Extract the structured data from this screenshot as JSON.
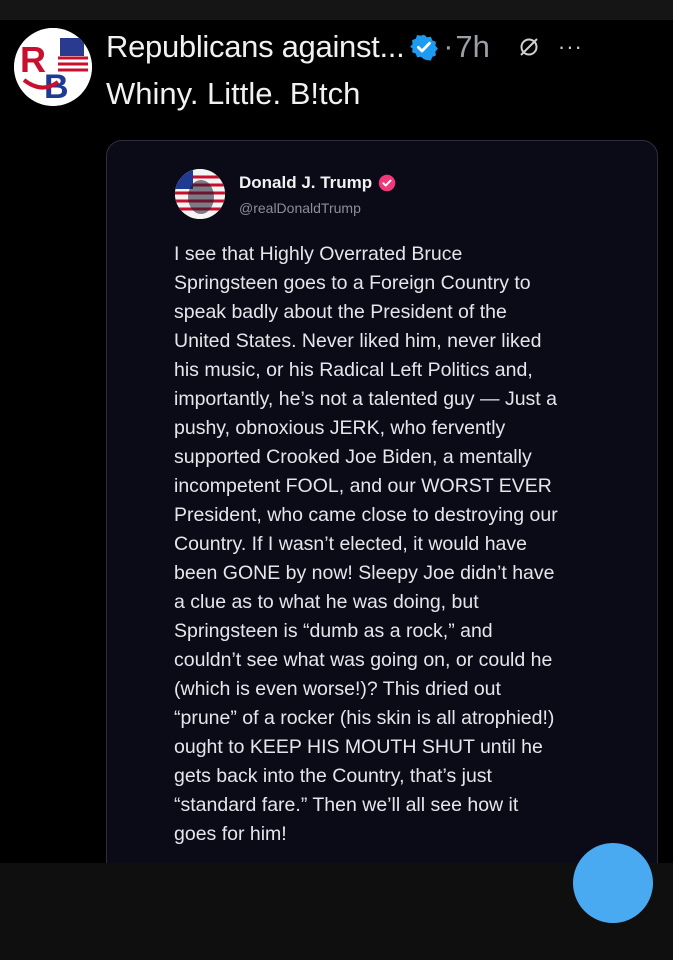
{
  "post": {
    "author_name": "Republicans against...",
    "avatar_initials": "RB",
    "separator": "·",
    "time_ago": "7h",
    "more_label": "···",
    "text": "Whiny. Little. B!tch",
    "verified_icon": "verified-badge-icon",
    "grok_icon": "grok-slash-icon"
  },
  "quote": {
    "name": "Donald J. Trump",
    "handle": "@realDonaldTrump",
    "badge_icon": "verified-badge-icon",
    "lines": [
      "I see that Highly Overrated Bruce",
      "Springsteen goes to a Foreign Country to",
      "speak badly about the President of the",
      "United States. Never liked him, never liked",
      "his music, or his Radical Left Politics and,",
      "importantly, he’s not a talented guy — Just a",
      "pushy, obnoxious JERK, who fervently",
      "supported Crooked Joe Biden, a mentally",
      "incompetent FOOL, and our WORST EVER",
      "President, who came close to destroying our",
      "Country. If I wasn’t elected, it would have",
      "been GONE by now! Sleepy Joe didn’t have",
      "a clue as to what he was doing, but",
      "Springsteen is “dumb as a rock,” and",
      "couldn’t see what was going on, or could he",
      "(which is even worse!)? This dried out",
      "“prune” of a rocker (his skin is all atrophied!)",
      "ought to KEEP HIS MOUTH SHUT until he",
      "gets back into the Country, that’s just",
      "“standard fare.” Then we’ll all see how it",
      "goes for him!"
    ]
  },
  "colors": {
    "background": "#000000",
    "card_background": "#0b0b18",
    "verified_blue": "#1d9bf0",
    "badge_pink": "#f0387a",
    "fab_blue": "#4aaaf1"
  },
  "fab": {
    "icon": "compose-icon"
  }
}
